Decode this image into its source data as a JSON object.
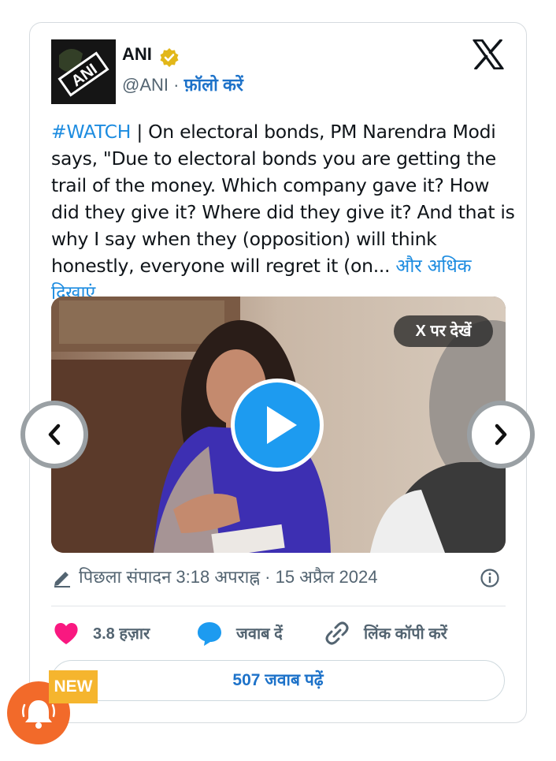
{
  "tweet": {
    "author_name": "ANI",
    "handle": "@ANI",
    "separator": "·",
    "follow_label": "फ़ॉलो करें",
    "avatar_text": "ANI",
    "hashtag": "#WATCH",
    "body": " | On electoral bonds, PM Narendra Modi says, \"Due to electoral bonds you are getting the trail of the money. Which company gave it? How did they give it? Where did they give it? And that is why I say when they (opposition) will think honestly, everyone will regret it (on...",
    "show_more": " और अधिक दिखाएं"
  },
  "media": {
    "watch_on_x": "X पर देखें"
  },
  "meta": {
    "edited_label": "पिछला संपादन 3:18 अपराह्न · 15 अप्रैल 2024"
  },
  "actions": {
    "likes": "3.8 हज़ार",
    "reply": "जवाब दें",
    "copy_link": "लिंक कॉपी करें"
  },
  "read_replies": "507 जवाब पढ़ें",
  "badge": "NEW",
  "colors": {
    "link_blue": "#1d8ce0",
    "like_pink": "#f91880",
    "play_blue": "#1d9bf0",
    "bell_orange": "#f26a2a",
    "badge_yellow": "#f5b52e"
  }
}
